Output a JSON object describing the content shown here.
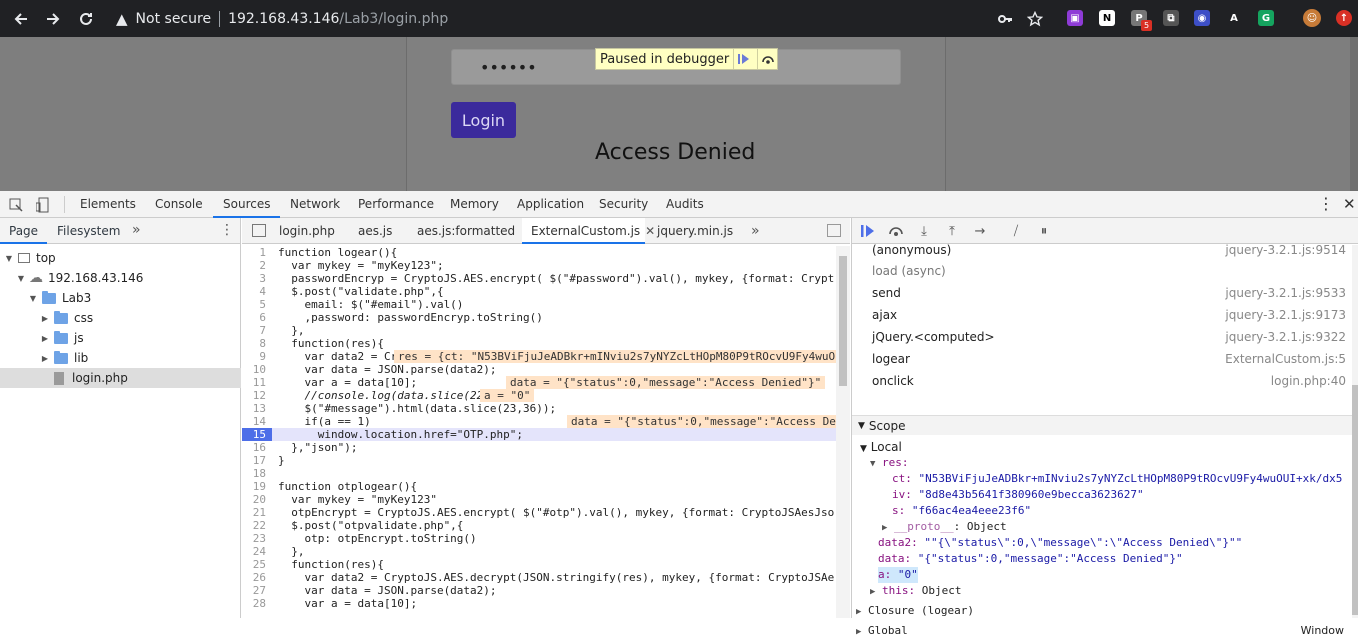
{
  "browser": {
    "security_label": "Not secure",
    "url_host": "192.168.43.146",
    "url_path": "/Lab3/login.php",
    "ext_badge": "5"
  },
  "page": {
    "password_mask": "••••••",
    "login_label": "Login",
    "message": "Access Denied",
    "debugger_banner": "Paused in debugger"
  },
  "devtools": {
    "tabs": [
      "Elements",
      "Console",
      "Sources",
      "Network",
      "Performance",
      "Memory",
      "Application",
      "Security",
      "Audits"
    ],
    "active_tab": "Sources",
    "nav_tabs": [
      "Page",
      "Filesystem"
    ],
    "tree": {
      "top": "top",
      "host": "192.168.43.146",
      "folder": "Lab3",
      "sub": [
        "css",
        "js",
        "lib"
      ],
      "file": "login.php"
    },
    "editor_tabs": [
      "login.php",
      "aes.js",
      "aes.js:formatted",
      "ExternalCustom.js",
      "jquery.min.js"
    ],
    "active_editor_tab": "ExternalCustom.js",
    "code_lines": [
      "function logear(){",
      "  var mykey = \"myKey123\";",
      "  passwordEncryp = CryptoJS.AES.encrypt( $(\"#password\").val(), mykey, {format: Crypt",
      "  $.post(\"validate.php\",{",
      "    email: $(\"#email\").val()",
      "    ,password: passwordEncryp.toString()",
      "  },",
      "  function(res){",
      "    var data2 = CryptoJS.AES.decrypt(JSON.stringify(res), mykey, {format: CryptoJSAe",
      "    var data = JSON.parse(data2);",
      "    var a = data[10];",
      "    //console.log(data.slice(22,37));",
      "    $(\"#message\").html(data.slice(23,36));",
      "    if(a == 1)",
      "      window.location.href=\"OTP.php\";",
      "  },\"json\");",
      "}",
      "",
      "function otplogear(){",
      "  var mykey = \"myKey123\"",
      "  otpEncrypt = CryptoJS.AES.encrypt( $(\"#otp\").val(), mykey, {format: CryptoJSAesJso",
      "  $.post(\"otpvalidate.php\",{",
      "    otp: otpEncrypt.toString()",
      "  },",
      "  function(res){",
      "    var data2 = CryptoJS.AES.decrypt(JSON.stringify(res), mykey, {format: CryptoJSAe",
      "    var data = JSON.parse(data2);",
      "    var a = data[10];"
    ],
    "current_line": 15,
    "inline_values": {
      "l9": "res = {ct: \"N53BViFjuJeADBkr+mINviu2s7yNYZcLtHOpM80P9tROcvU9Fy4wuO",
      "l11": "data = \"{\"status\":0,\"message\":\"Access Denied\"}\"",
      "l12": "a = \"0\"",
      "l14": "data = \"{\"status\":0,\"message\":\"Access De"
    },
    "call_stack": [
      {
        "fn": "(anonymous)",
        "loc": "jquery-3.2.1.js:9514"
      },
      {
        "fn": "load (async)",
        "loc": ""
      },
      {
        "fn": "send",
        "loc": "jquery-3.2.1.js:9533"
      },
      {
        "fn": "ajax",
        "loc": "jquery-3.2.1.js:9173"
      },
      {
        "fn": "jQuery.<computed>",
        "loc": "jquery-3.2.1.js:9322"
      },
      {
        "fn": "logear",
        "loc": "ExternalCustom.js:5"
      },
      {
        "fn": "onclick",
        "loc": "login.php:40"
      }
    ],
    "scope": {
      "title": "Scope",
      "local": "Local",
      "res_label": "res:",
      "ct": "\"N53BViFjuJeADBkr+mINviu2s7yNYZcLtHOpM80P9tROcvU9Fy4wuOUI+xk/dx5",
      "iv": "\"8d8e43b5641f380960e9becca3623627\"",
      "s": "\"f66ac4ea4eee23f6\"",
      "proto": "__proto__",
      "proto_val": "Object",
      "data2": "\"\"{\\\"status\\\":0,\\\"message\\\":\\\"Access Denied\\\"}\"\"",
      "data": "\"{\"status\":0,\"message\":\"Access Denied\"}\"",
      "a": "\"0\"",
      "this_val": "Object",
      "closure": "Closure (logear)",
      "global": "Global",
      "global_val": "Window"
    }
  }
}
